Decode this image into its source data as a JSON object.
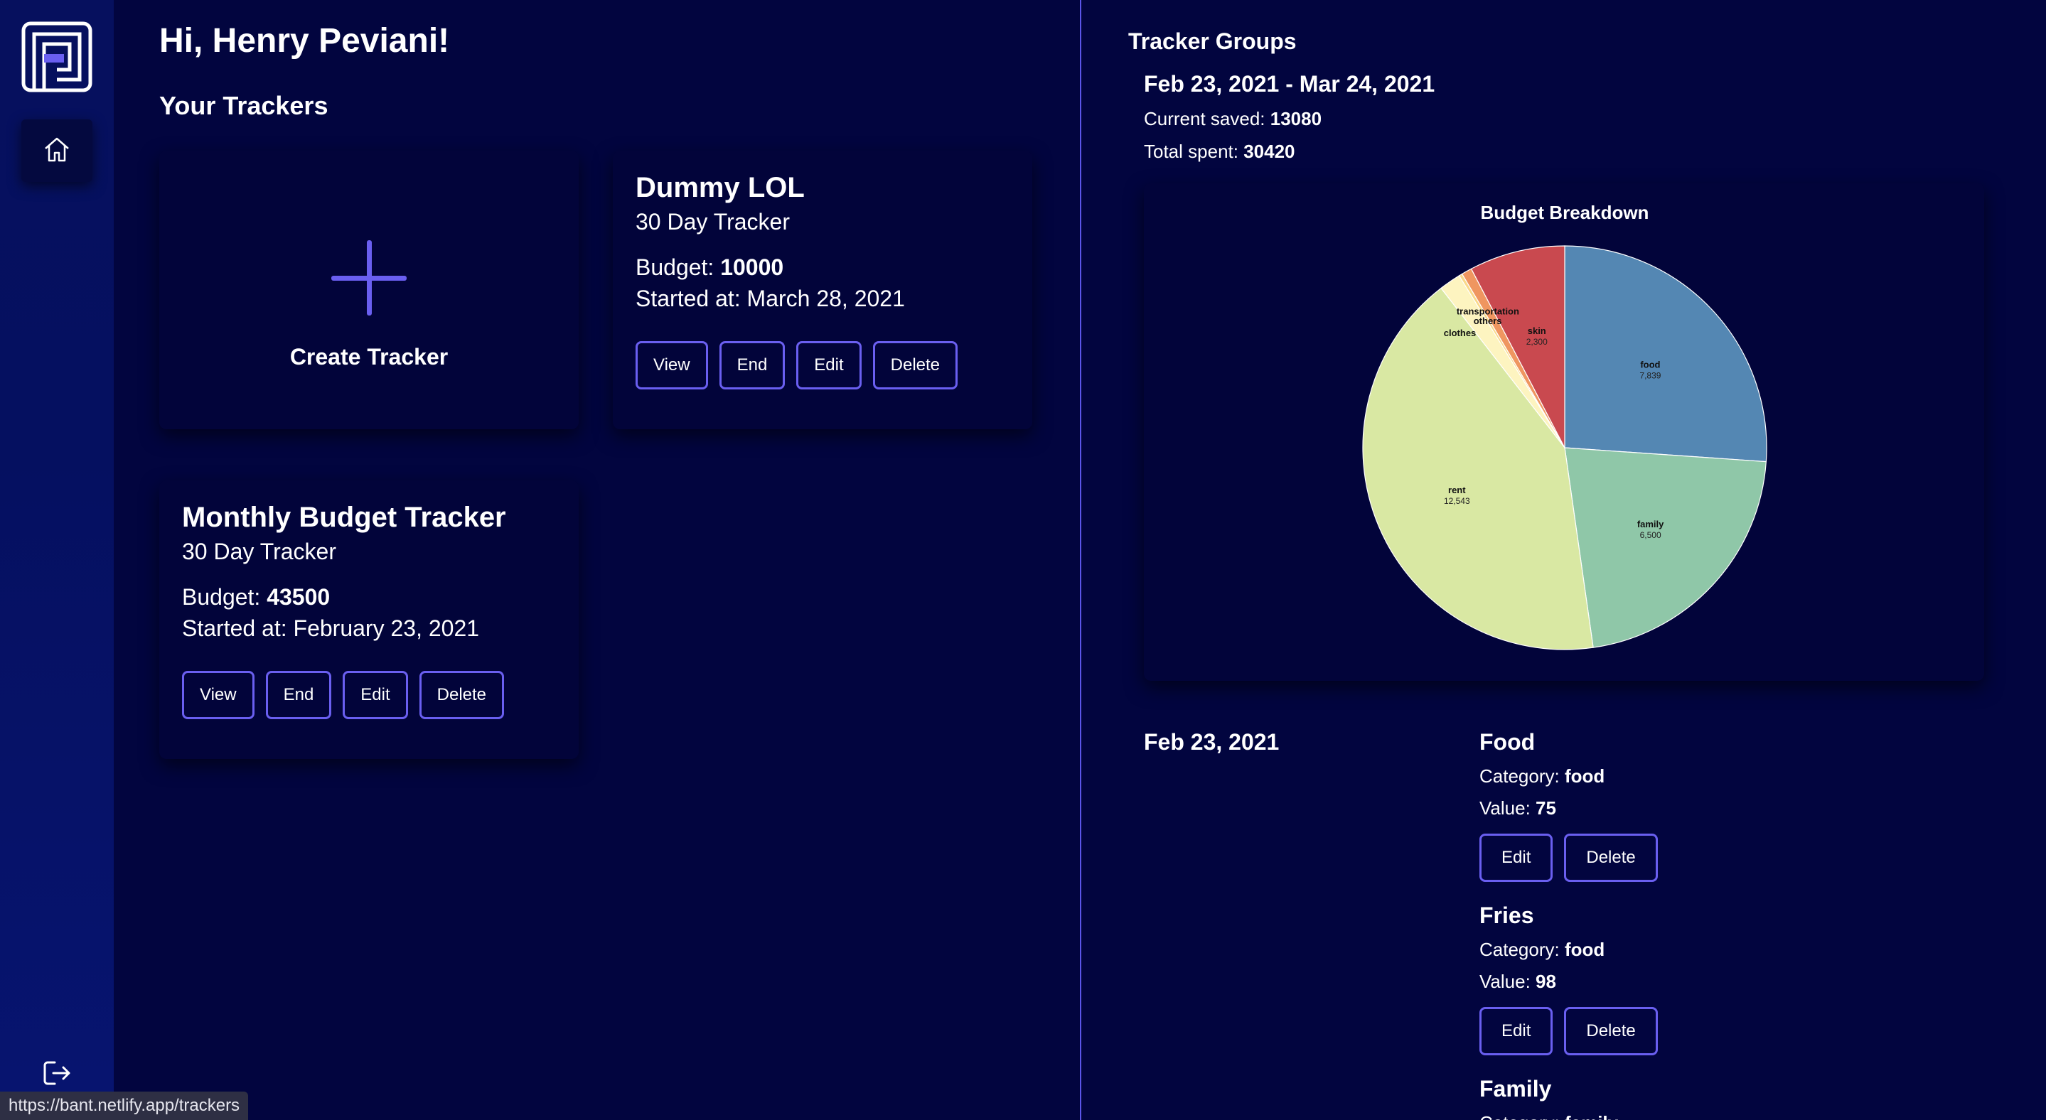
{
  "greeting": "Hi, Henry Peviani!",
  "trackers_heading": "Your Trackers",
  "create_tracker_label": "Create Tracker",
  "trackers": [
    {
      "title": "Dummy LOL",
      "subtitle": "30 Day Tracker",
      "budget_label": "Budget: ",
      "budget": "10000",
      "started": "Started at: March 28, 2021"
    },
    {
      "title": "Monthly Budget Tracker",
      "subtitle": "30 Day Tracker",
      "budget_label": "Budget: ",
      "budget": "43500",
      "started": "Started at: February 23, 2021"
    }
  ],
  "buttons": {
    "view": "View",
    "end": "End",
    "edit": "Edit",
    "delete": "Delete"
  },
  "status_url": "https://bant.netlify.app/trackers",
  "tracker_groups": {
    "heading": "Tracker Groups",
    "range": "Feb 23, 2021 - Mar 24, 2021",
    "saved_label": "Current saved: ",
    "saved": "13080",
    "spent_label": "Total spent: ",
    "spent": "30420"
  },
  "chart_data": {
    "type": "pie",
    "title": "Budget Breakdown",
    "slices": [
      {
        "label": "food",
        "value": 7839,
        "display": "7,839",
        "color": "#5487b3"
      },
      {
        "label": "family",
        "value": 6500,
        "display": "6,500",
        "color": "#8fc7a8"
      },
      {
        "label": "rent",
        "value": 12543,
        "display": "12,543",
        "color": "#d9e8a3"
      },
      {
        "label": "clothes",
        "value": 520,
        "display": "",
        "color": "#fdf4c0"
      },
      {
        "label": "others",
        "value": 80,
        "display": "",
        "color": "#f9d98a"
      },
      {
        "label": "transportation",
        "value": 250,
        "display": "",
        "color": "#ef9660"
      },
      {
        "label": "skin",
        "value": 2300,
        "display": "2,300",
        "color": "#c9494f"
      }
    ]
  },
  "day_date": "Feb 23, 2021",
  "entries": [
    {
      "name": "Food",
      "category_label": "Category: ",
      "category": "food",
      "value_label": "Value: ",
      "value": "75"
    },
    {
      "name": "Fries",
      "category_label": "Category: ",
      "category": "food",
      "value_label": "Value: ",
      "value": "98"
    },
    {
      "name": "Family",
      "category_label": "Category: ",
      "category": "family",
      "value_label": "",
      "value": ""
    }
  ],
  "icons": {
    "logo": "app-logo-icon",
    "home": "home-icon",
    "logout": "logout-icon"
  },
  "colors": {
    "background": "#02053f",
    "accent": "#6a5ff0",
    "sidebar": "#06105e"
  }
}
